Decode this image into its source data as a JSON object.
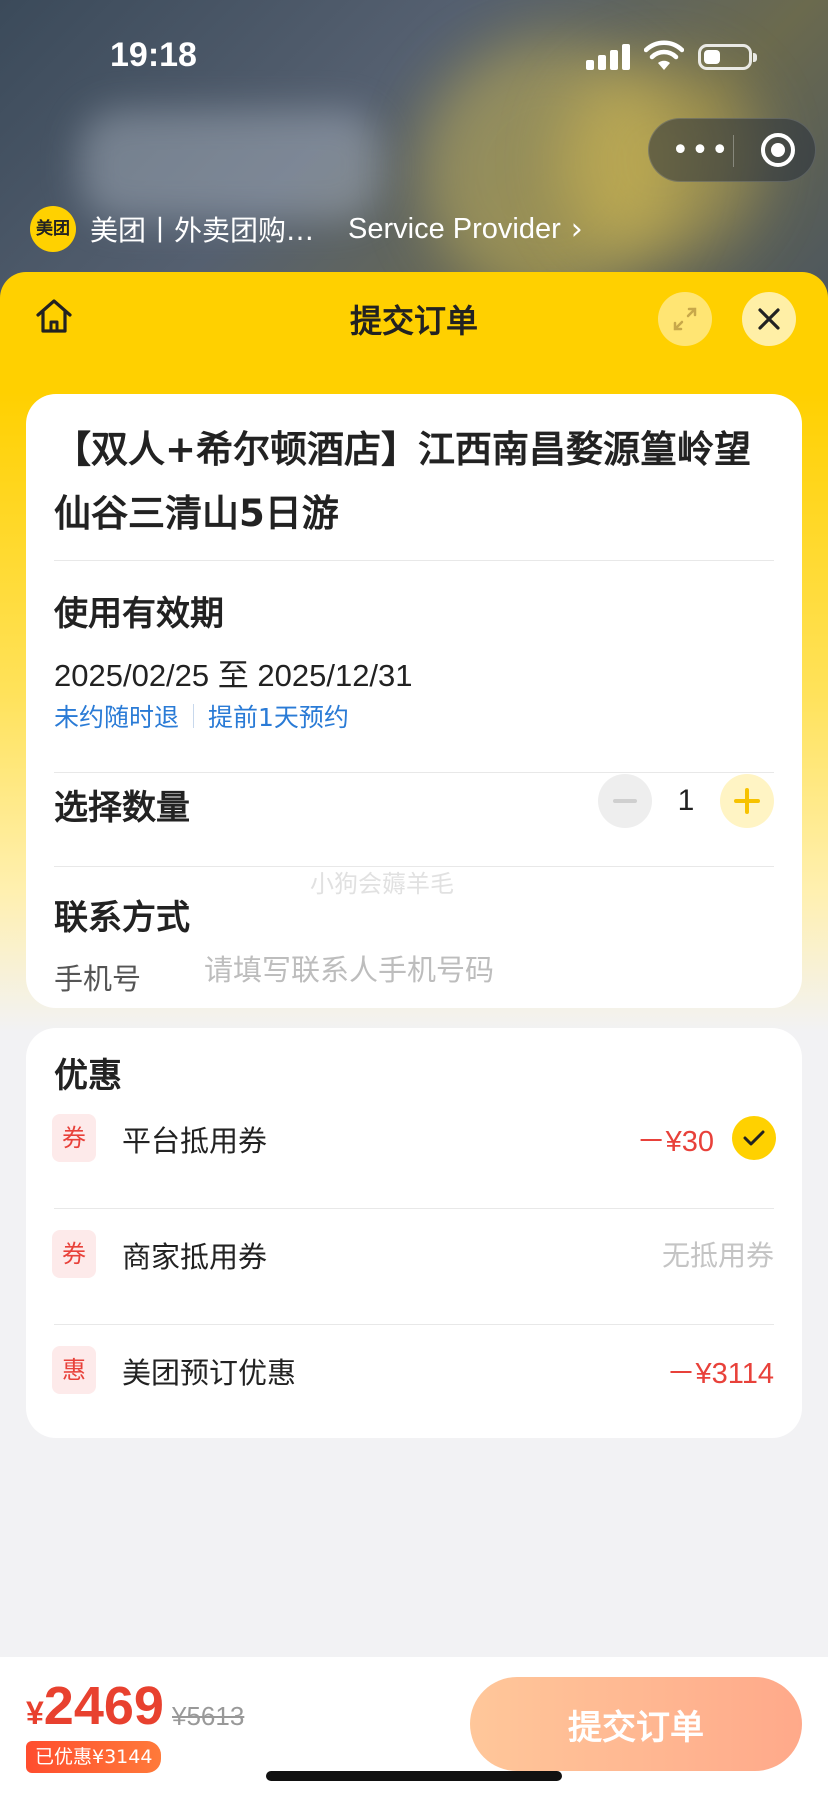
{
  "status_bar": {
    "time": "19:18"
  },
  "header": {
    "logo_text": "美团",
    "provider_name": "美团丨外卖团购…",
    "provider_link": "Service Provider",
    "capsule_more": "•••"
  },
  "sheet": {
    "title": "提交订单"
  },
  "product": {
    "title": "【双人+希尔顿酒店】江西南昌婺源篁岭望仙谷三清山5日游",
    "validity_label": "使用有效期",
    "validity_range": "2025/02/25 至 2025/12/31",
    "tags": [
      "未约随时退",
      "提前1天预约"
    ]
  },
  "quantity": {
    "label": "选择数量",
    "value": "1"
  },
  "watermark": "小狗会薅羊毛",
  "contact": {
    "label": "联系方式",
    "phone_label": "手机号",
    "phone_placeholder": "请填写联系人手机号码",
    "phone_value": ""
  },
  "discounts": {
    "title": "优惠",
    "items": [
      {
        "badge": "券",
        "label": "平台抵用券",
        "amount": "－¥30",
        "checked": true
      },
      {
        "badge": "券",
        "label": "商家抵用券",
        "status": "无抵用券"
      },
      {
        "badge": "惠",
        "label": "美团预订优惠",
        "amount": "－¥3114"
      }
    ]
  },
  "footer": {
    "currency": "¥",
    "price": "2469",
    "original_price": "¥5613",
    "saved": "已优惠¥3144",
    "submit_label": "提交订单"
  },
  "colors": {
    "brand_yellow": "#ffd100",
    "price_red": "#e8412f",
    "link_blue": "#2a7bd6",
    "submit_gradient_start": "#ffc79a",
    "submit_gradient_end": "#ffa98a"
  }
}
